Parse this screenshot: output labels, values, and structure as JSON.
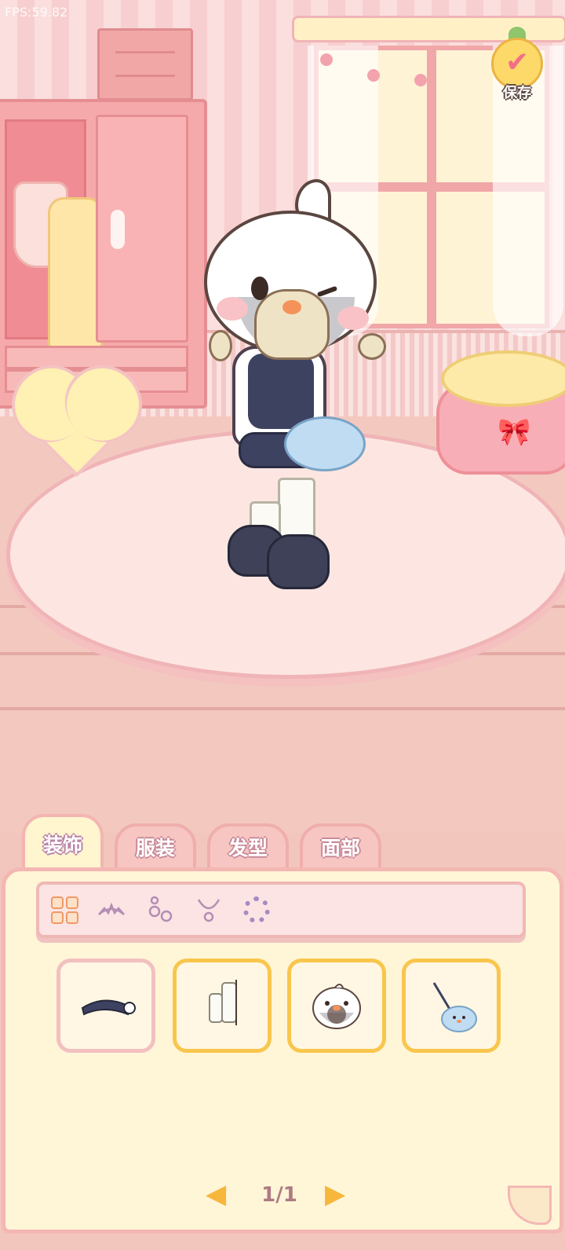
{
  "hud": {
    "fps": "FPS:59.82"
  },
  "save": {
    "label": "保存"
  },
  "tabs": [
    {
      "label": "装饰",
      "active": true
    },
    {
      "label": "服装",
      "active": false
    },
    {
      "label": "发型",
      "active": false
    },
    {
      "label": "面部",
      "active": false
    }
  ],
  "subcategories": [
    {
      "icon": "all-grid-icon",
      "active": true
    },
    {
      "icon": "tiara-icon",
      "active": false
    },
    {
      "icon": "earrings-icon",
      "active": false
    },
    {
      "icon": "necklace-icon",
      "active": false
    },
    {
      "icon": "wreath-icon",
      "active": false
    }
  ],
  "items": [
    {
      "icon": "navy-hat-icon",
      "equipped": false
    },
    {
      "icon": "white-socks-icon",
      "equipped": true
    },
    {
      "icon": "bird-mask-icon",
      "equipped": true
    },
    {
      "icon": "bird-bag-icon",
      "equipped": true
    }
  ],
  "pagination": {
    "text": "1/1"
  },
  "colors": {
    "accent": "#f9c64d",
    "tab_border": "#efaeac",
    "panel_bg": "#fff6d8"
  }
}
